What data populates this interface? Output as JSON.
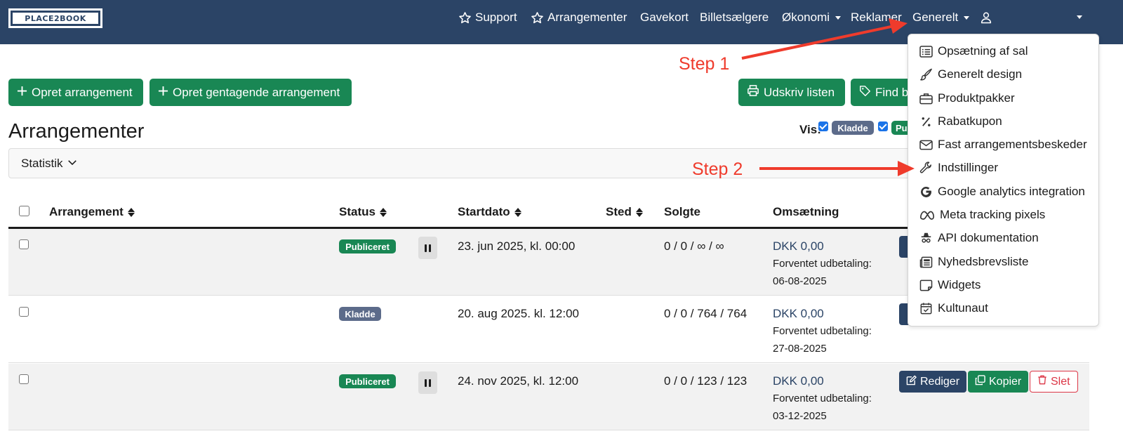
{
  "brand": {
    "logo_text": "PLACE2BOOK"
  },
  "nav": {
    "support": "Support",
    "arrangementer": "Arrangementer",
    "gavekort": "Gavekort",
    "billetsaelgere": "Billetsælgere",
    "okonomi": "Økonomi",
    "reklamer": "Reklamer",
    "generelt": "Generelt"
  },
  "toolbar": {
    "create": "Opret arrangement",
    "create_recurring": "Opret gentagende arrangement",
    "print": "Udskriv listen",
    "find": "Find b"
  },
  "page": {
    "title": "Arrangementer"
  },
  "filter": {
    "label": "Vis:",
    "kladde": "Kladde",
    "publiceret": "Pu"
  },
  "stats": {
    "label": "Statistik"
  },
  "table": {
    "headers": {
      "arrangement": "Arrangement",
      "status": "Status",
      "startdato": "Startdato",
      "sted": "Sted",
      "solgte": "Solgte",
      "omsaetning": "Omsætning"
    },
    "rows": [
      {
        "status": "Publiceret",
        "start": "23. jun 2025, kl. 00:00",
        "sold": "0 / 0 / ∞ / ∞",
        "revenue": "DKK 0,00",
        "payout_label": "Forventet udbetaling:",
        "payout_date": "06-08-2025"
      },
      {
        "status": "Kladde",
        "start": "20. aug 2025. kl. 12:00",
        "sold": "0 / 0 / 764 / 764",
        "revenue": "DKK 0,00",
        "payout_label": "Forventet udbetaling:",
        "payout_date": "27-08-2025"
      },
      {
        "status": "Publiceret",
        "start": "24. nov 2025, kl. 12:00",
        "sold": "0 / 0 / 123 / 123",
        "revenue": "DKK 0,00",
        "payout_label": "Forventet udbetaling:",
        "payout_date": "03-12-2025"
      }
    ],
    "actions": {
      "edit": "Rediger",
      "copy": "Kopier",
      "delete": "Slet"
    }
  },
  "dropdown": {
    "items": [
      {
        "label": "Opsætning af sal",
        "icon": "list-icon"
      },
      {
        "label": "Generelt design",
        "icon": "brush-icon"
      },
      {
        "label": "Produktpakker",
        "icon": "briefcase-icon"
      },
      {
        "label": "Rabatkupon",
        "icon": "percent-icon"
      },
      {
        "label": "Fast arrangementsbeskeder",
        "icon": "envelope-icon"
      },
      {
        "label": "Indstillinger",
        "icon": "wrench-icon"
      },
      {
        "label": "Google analytics integration",
        "icon": "google-icon"
      },
      {
        "label": "Meta tracking pixels",
        "icon": "meta-icon"
      },
      {
        "label": "API dokumentation",
        "icon": "incognito-icon"
      },
      {
        "label": "Nyhedsbrevsliste",
        "icon": "newspaper-icon"
      },
      {
        "label": "Widgets",
        "icon": "sticky-icon"
      },
      {
        "label": "Kultunaut",
        "icon": "calendar-check-icon"
      }
    ]
  },
  "annotations": {
    "step1": "Step 1",
    "step2": "Step 2"
  },
  "colors": {
    "navbar": "#2b4466",
    "success": "#198754",
    "draft": "#5c6b8a",
    "danger": "#dc3545",
    "annotation": "#ef3b2c"
  }
}
